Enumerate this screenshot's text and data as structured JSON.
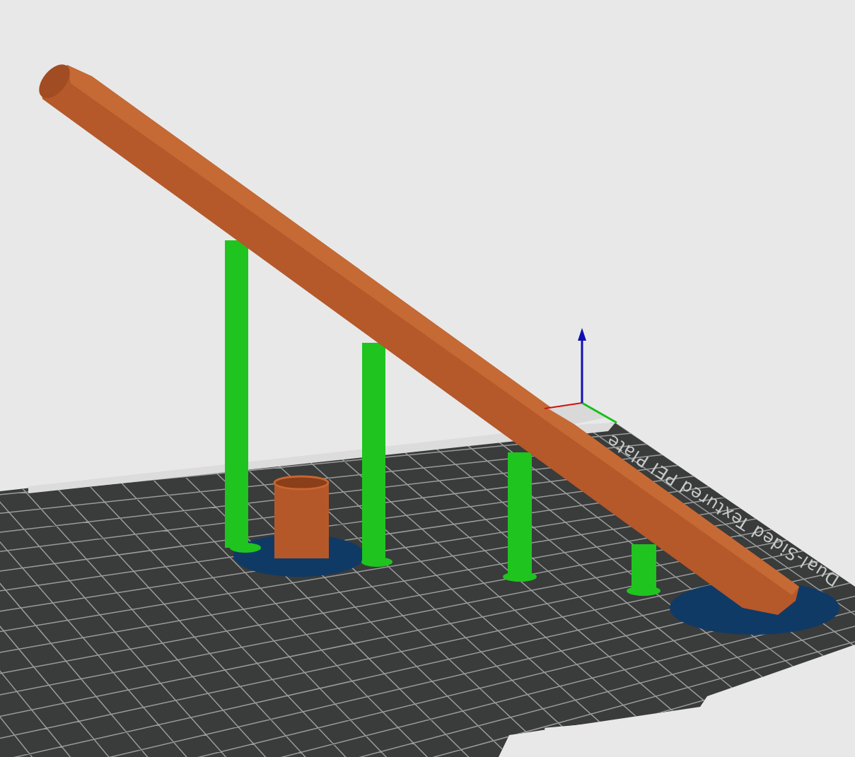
{
  "viewport": {
    "bed_label": "Dual-Sided Textured PEI Plate"
  }
}
